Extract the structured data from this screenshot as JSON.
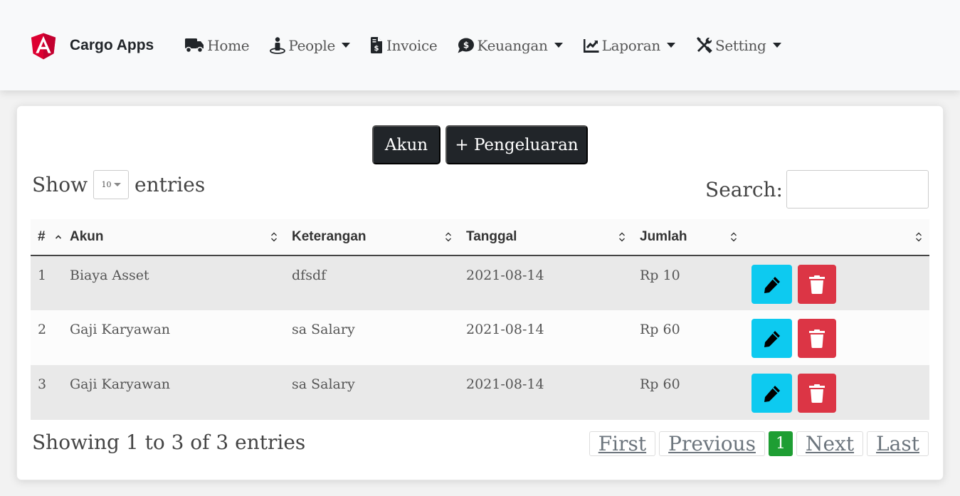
{
  "app": {
    "brand": "Cargo Apps",
    "brand_color": "#dd0031"
  },
  "nav": {
    "items": [
      {
        "label": "Home",
        "icon": "truck-icon",
        "dropdown": false
      },
      {
        "label": "People",
        "icon": "street-view-icon",
        "dropdown": true
      },
      {
        "label": "Invoice",
        "icon": "file-invoice-dollar-icon",
        "dropdown": false
      },
      {
        "label": "Keuangan",
        "icon": "comment-dollar-icon",
        "dropdown": true
      },
      {
        "label": "Laporan",
        "icon": "chart-line-icon",
        "dropdown": true
      },
      {
        "label": "Setting",
        "icon": "tools-icon",
        "dropdown": true
      }
    ]
  },
  "toolbar": {
    "akun_label": "Akun",
    "pengeluaran_label": "+ Pengeluaran"
  },
  "length": {
    "prefix": "Show",
    "value": "10",
    "suffix": "entries"
  },
  "search": {
    "label": "Search:",
    "value": ""
  },
  "table": {
    "columns": [
      "#",
      "Akun",
      "Keterangan",
      "Tanggal",
      "Jumlah",
      ""
    ],
    "rows": [
      {
        "no": "1",
        "akun": "Biaya Asset",
        "keterangan": "dfsdf",
        "tanggal": "2021-08-14",
        "jumlah": "Rp 10"
      },
      {
        "no": "2",
        "akun": "Gaji Karyawan",
        "keterangan": "sa Salary",
        "tanggal": "2021-08-14",
        "jumlah": "Rp 60"
      },
      {
        "no": "3",
        "akun": "Gaji Karyawan",
        "keterangan": "sa Salary",
        "tanggal": "2021-08-14",
        "jumlah": "Rp 60"
      }
    ]
  },
  "footer": {
    "info": "Showing 1 to 3 of 3 entries",
    "pagination": {
      "first": "First",
      "previous": "Previous",
      "current": "1",
      "next": "Next",
      "last": "Last"
    }
  },
  "colors": {
    "edit": "#0dcaf0",
    "delete": "#dc3545",
    "active_page": "#1e9e33",
    "dark_button": "#212529"
  }
}
